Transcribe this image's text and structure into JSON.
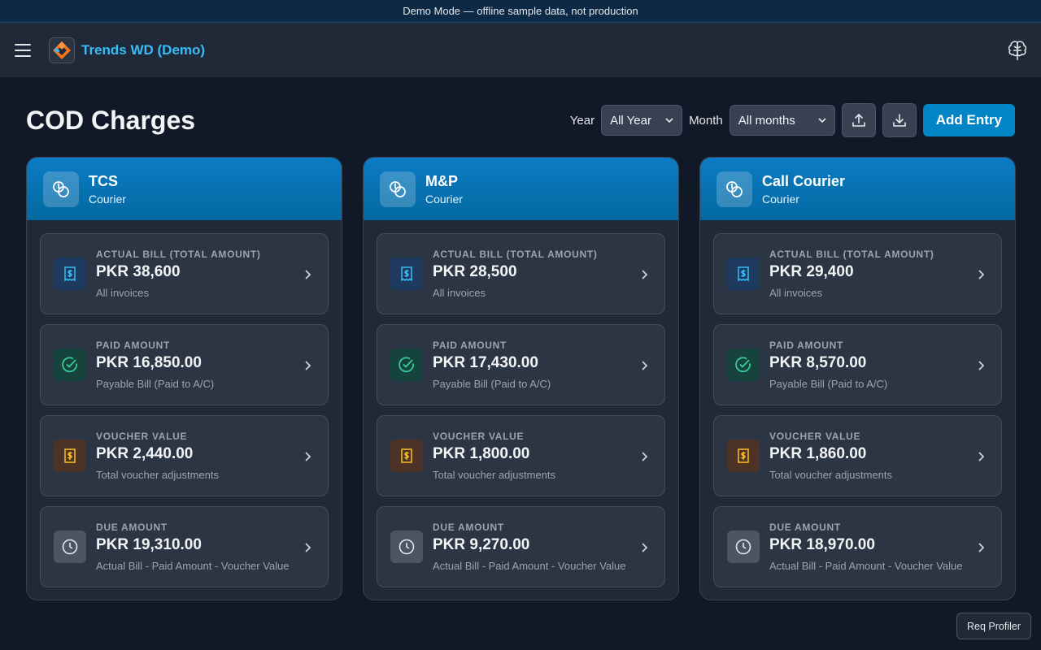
{
  "banner": {
    "text": "Demo Mode — offline sample data, not production"
  },
  "topbar": {
    "brand": "Trends WD (Demo)",
    "menu_icon": "hamburger-icon",
    "right_icon": "brain-icon"
  },
  "page": {
    "title": "COD Charges"
  },
  "filters": {
    "year_label": "Year",
    "year_value": "All Year",
    "month_label": "Month",
    "month_value": "All months",
    "upload_icon": "upload-icon",
    "download_icon": "download-icon",
    "add_label": "Add Entry"
  },
  "colors": {
    "accent": "#0284c7",
    "brand": "#38bdf8",
    "bg": "#111827",
    "card": "#1f2937"
  },
  "cards": [
    {
      "name": "TCS",
      "sub": "Courier",
      "metrics": [
        {
          "label": "ACTUAL BILL (TOTAL AMOUNT)",
          "value": "PKR 38,600",
          "sub": "All invoices"
        },
        {
          "label": "PAID AMOUNT",
          "value": "PKR 16,850.00",
          "sub": "Payable Bill (Paid to A/C)"
        },
        {
          "label": "VOUCHER VALUE",
          "value": "PKR 2,440.00",
          "sub": "Total voucher adjustments"
        },
        {
          "label": "DUE AMOUNT",
          "value": "PKR 19,310.00",
          "sub": "Actual Bill - Paid Amount - Voucher Value"
        }
      ]
    },
    {
      "name": "M&P",
      "sub": "Courier",
      "metrics": [
        {
          "label": "ACTUAL BILL (TOTAL AMOUNT)",
          "value": "PKR 28,500",
          "sub": "All invoices"
        },
        {
          "label": "PAID AMOUNT",
          "value": "PKR 17,430.00",
          "sub": "Payable Bill (Paid to A/C)"
        },
        {
          "label": "VOUCHER VALUE",
          "value": "PKR 1,800.00",
          "sub": "Total voucher adjustments"
        },
        {
          "label": "DUE AMOUNT",
          "value": "PKR 9,270.00",
          "sub": "Actual Bill - Paid Amount - Voucher Value"
        }
      ]
    },
    {
      "name": "Call Courier",
      "sub": "Courier",
      "metrics": [
        {
          "label": "ACTUAL BILL (TOTAL AMOUNT)",
          "value": "PKR 29,400",
          "sub": "All invoices"
        },
        {
          "label": "PAID AMOUNT",
          "value": "PKR 8,570.00",
          "sub": "Payable Bill (Paid to A/C)"
        },
        {
          "label": "VOUCHER VALUE",
          "value": "PKR 1,860.00",
          "sub": "Total voucher adjustments"
        },
        {
          "label": "DUE AMOUNT",
          "value": "PKR 18,970.00",
          "sub": "Actual Bill - Paid Amount - Voucher Value"
        }
      ]
    }
  ],
  "profiler": {
    "label": "Req Profiler"
  }
}
